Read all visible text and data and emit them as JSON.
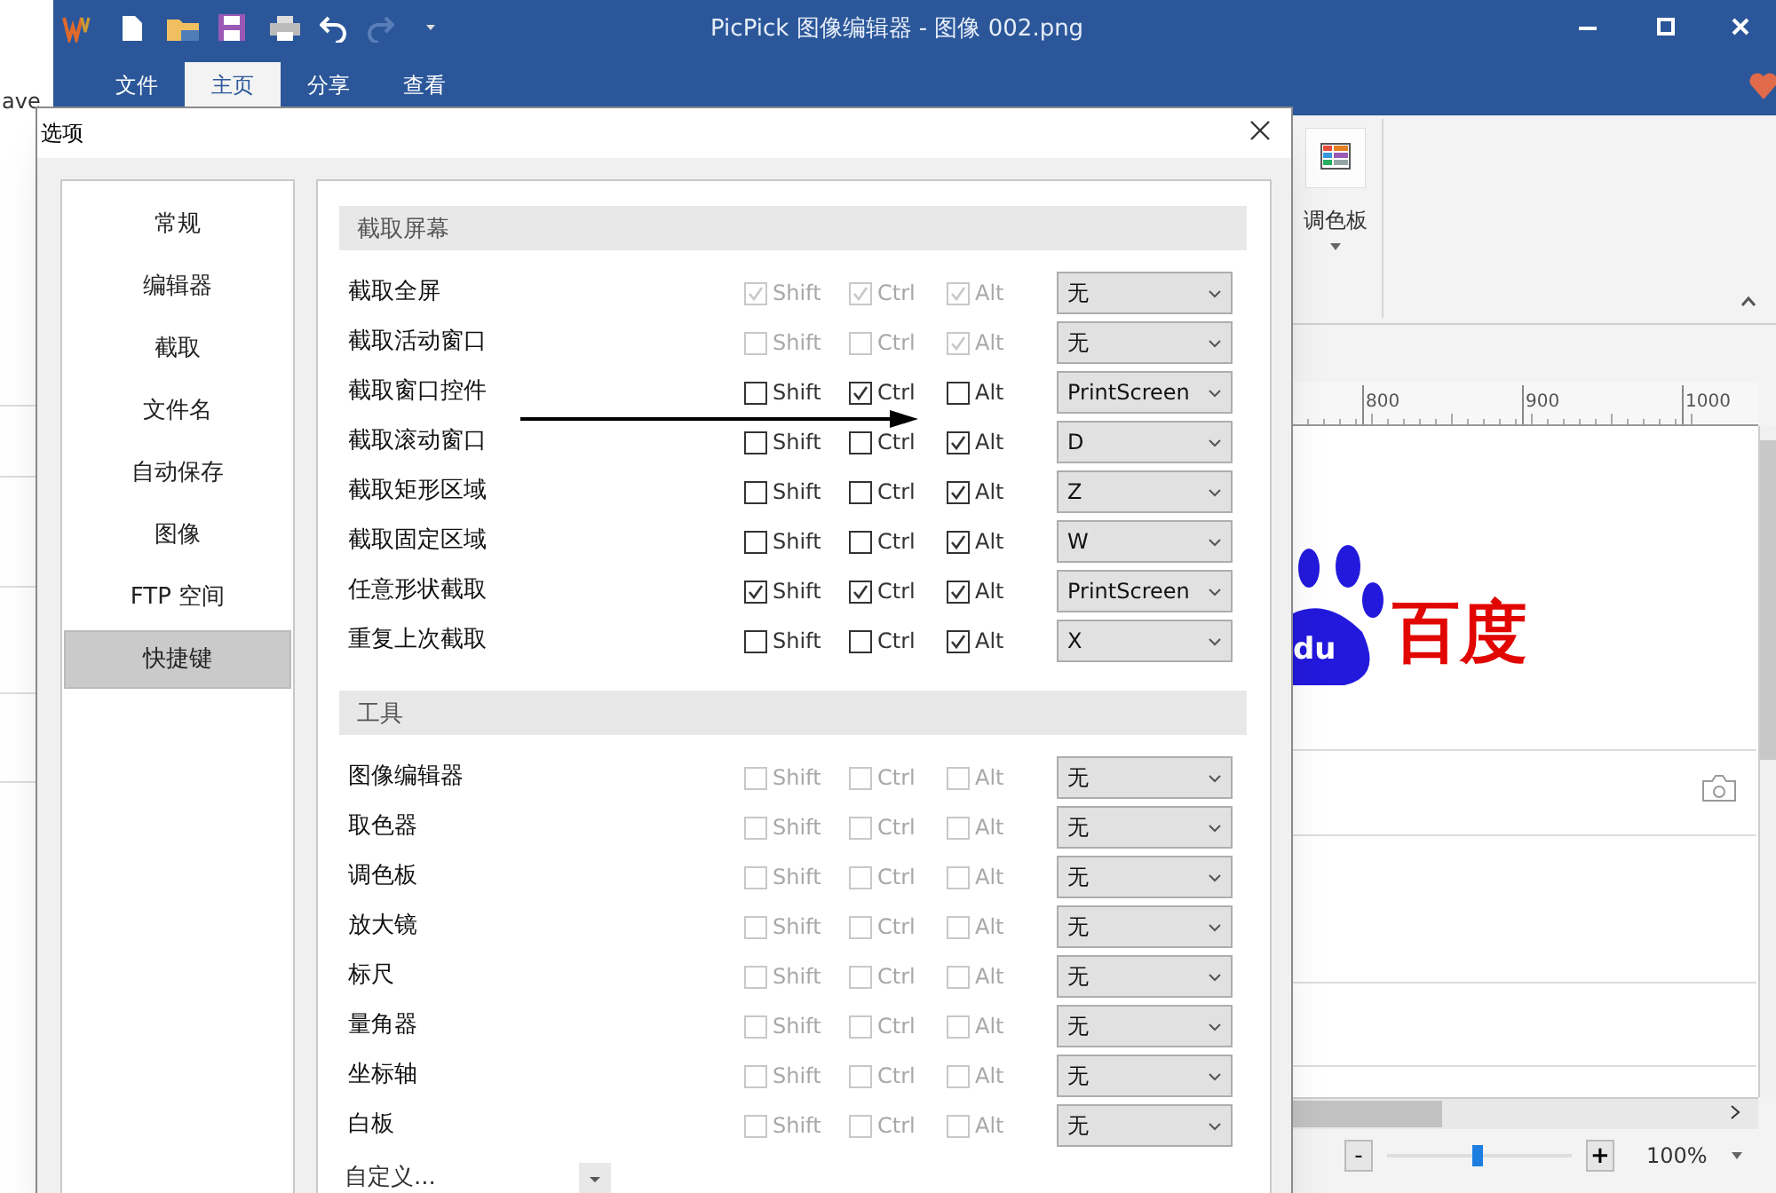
{
  "background_window": {
    "title": "PicPick 图像编辑器 - 图像 002.png",
    "left_strip_text": "ave",
    "ribbon_tabs": [
      {
        "label": "文件",
        "selected": false
      },
      {
        "label": "主页",
        "selected": true
      },
      {
        "label": "分享",
        "selected": false
      },
      {
        "label": "查看",
        "selected": false
      }
    ],
    "ribbon_button": {
      "label": "调色板"
    },
    "ruler_labels": [
      "800",
      "900",
      "1000"
    ],
    "canvas_logo": {
      "paw_text": "du",
      "text": "百度"
    },
    "zoom": {
      "minus": "-",
      "plus": "+",
      "level": 0.48,
      "value": "100%"
    }
  },
  "dialog": {
    "title": "选项",
    "sidebar": [
      {
        "label": "常规",
        "selected": false
      },
      {
        "label": "编辑器",
        "selected": false
      },
      {
        "label": "截取",
        "selected": false
      },
      {
        "label": "文件名",
        "selected": false
      },
      {
        "label": "自动保存",
        "selected": false
      },
      {
        "label": "图像",
        "selected": false
      },
      {
        "label": "FTP 空间",
        "selected": false
      },
      {
        "label": "快捷键",
        "selected": true
      }
    ],
    "sections": [
      {
        "title": "截取屏幕",
        "rows": [
          {
            "label": "截取全屏",
            "disabled": true,
            "modifiers": [
              {
                "label": "Shift",
                "checked": true
              },
              {
                "label": "Ctrl",
                "checked": true
              },
              {
                "label": "Alt",
                "checked": true
              }
            ],
            "key": "无"
          },
          {
            "label": "截取活动窗口",
            "disabled": true,
            "modifiers": [
              {
                "label": "Shift",
                "checked": false
              },
              {
                "label": "Ctrl",
                "checked": false
              },
              {
                "label": "Alt",
                "checked": true
              }
            ],
            "key": "无"
          },
          {
            "label": "截取窗口控件",
            "disabled": false,
            "modifiers": [
              {
                "label": "Shift",
                "checked": false
              },
              {
                "label": "Ctrl",
                "checked": true
              },
              {
                "label": "Alt",
                "checked": false
              }
            ],
            "key": "PrintScreen"
          },
          {
            "label": "截取滚动窗口",
            "disabled": false,
            "modifiers": [
              {
                "label": "Shift",
                "checked": false
              },
              {
                "label": "Ctrl",
                "checked": false
              },
              {
                "label": "Alt",
                "checked": true
              }
            ],
            "key": "D"
          },
          {
            "label": "截取矩形区域",
            "disabled": false,
            "modifiers": [
              {
                "label": "Shift",
                "checked": false
              },
              {
                "label": "Ctrl",
                "checked": false
              },
              {
                "label": "Alt",
                "checked": true
              }
            ],
            "key": "Z"
          },
          {
            "label": "截取固定区域",
            "disabled": false,
            "modifiers": [
              {
                "label": "Shift",
                "checked": false
              },
              {
                "label": "Ctrl",
                "checked": false
              },
              {
                "label": "Alt",
                "checked": true
              }
            ],
            "key": "W"
          },
          {
            "label": "任意形状截取",
            "disabled": false,
            "modifiers": [
              {
                "label": "Shift",
                "checked": true
              },
              {
                "label": "Ctrl",
                "checked": true
              },
              {
                "label": "Alt",
                "checked": true
              }
            ],
            "key": "PrintScreen"
          },
          {
            "label": "重复上次截取",
            "disabled": false,
            "modifiers": [
              {
                "label": "Shift",
                "checked": false
              },
              {
                "label": "Ctrl",
                "checked": false
              },
              {
                "label": "Alt",
                "checked": true
              }
            ],
            "key": "X"
          }
        ]
      },
      {
        "title": "工具",
        "rows": [
          {
            "label": "图像编辑器",
            "disabled": true,
            "modifiers": [
              {
                "label": "Shift",
                "checked": false
              },
              {
                "label": "Ctrl",
                "checked": false
              },
              {
                "label": "Alt",
                "checked": false
              }
            ],
            "key": "无"
          },
          {
            "label": "取色器",
            "disabled": true,
            "modifiers": [
              {
                "label": "Shift",
                "checked": false
              },
              {
                "label": "Ctrl",
                "checked": false
              },
              {
                "label": "Alt",
                "checked": false
              }
            ],
            "key": "无"
          },
          {
            "label": "调色板",
            "disabled": true,
            "modifiers": [
              {
                "label": "Shift",
                "checked": false
              },
              {
                "label": "Ctrl",
                "checked": false
              },
              {
                "label": "Alt",
                "checked": false
              }
            ],
            "key": "无"
          },
          {
            "label": "放大镜",
            "disabled": true,
            "modifiers": [
              {
                "label": "Shift",
                "checked": false
              },
              {
                "label": "Ctrl",
                "checked": false
              },
              {
                "label": "Alt",
                "checked": false
              }
            ],
            "key": "无"
          },
          {
            "label": "标尺",
            "disabled": true,
            "modifiers": [
              {
                "label": "Shift",
                "checked": false
              },
              {
                "label": "Ctrl",
                "checked": false
              },
              {
                "label": "Alt",
                "checked": false
              }
            ],
            "key": "无"
          },
          {
            "label": "量角器",
            "disabled": true,
            "modifiers": [
              {
                "label": "Shift",
                "checked": false
              },
              {
                "label": "Ctrl",
                "checked": false
              },
              {
                "label": "Alt",
                "checked": false
              }
            ],
            "key": "无"
          },
          {
            "label": "坐标轴",
            "disabled": true,
            "modifiers": [
              {
                "label": "Shift",
                "checked": false
              },
              {
                "label": "Ctrl",
                "checked": false
              },
              {
                "label": "Alt",
                "checked": false
              }
            ],
            "key": "无"
          },
          {
            "label": "白板",
            "disabled": true,
            "modifiers": [
              {
                "label": "Shift",
                "checked": false
              },
              {
                "label": "Ctrl",
                "checked": false
              },
              {
                "label": "Alt",
                "checked": false
              }
            ],
            "key": "无"
          }
        ]
      }
    ],
    "custom": {
      "label": "自定义..."
    }
  }
}
